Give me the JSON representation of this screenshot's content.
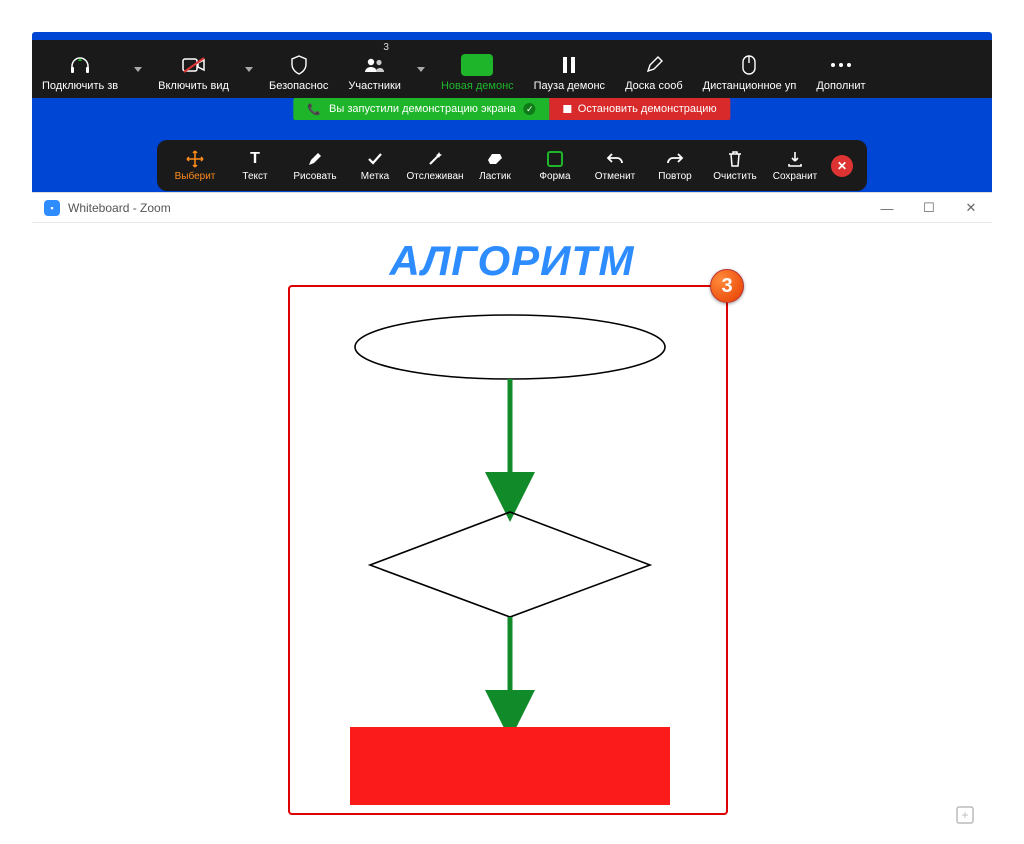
{
  "meeting_toolbar": {
    "audio": "Подключить зв",
    "video": "Включить вид",
    "security": "Безопаснос",
    "participants": "Участники",
    "participants_count": "3",
    "new_share": "Новая демонс",
    "pause_share": "Пауза демонс",
    "whiteboard": "Доска сооб",
    "remote": "Дистанционное уп",
    "more": "Дополнит"
  },
  "share_status": {
    "running": "Вы запустили демонстрацию экрана",
    "stop": "Остановить демонстрацию"
  },
  "annotate": {
    "select": "Выберит",
    "text": "Текст",
    "draw": "Рисовать",
    "stamp": "Метка",
    "spotlight": "Отслеживан",
    "eraser": "Ластик",
    "format": "Форма",
    "undo": "Отменит",
    "redo": "Повтор",
    "clear": "Очистить",
    "save": "Сохранит"
  },
  "whiteboard": {
    "window_title": "Whiteboard - Zoom",
    "heading": "АЛГОРИТМ",
    "step_badge": "3"
  },
  "diagram": {
    "shapes": [
      "terminator-ellipse",
      "arrow-down",
      "decision-rhombus",
      "arrow-down",
      "process-rect-red"
    ]
  }
}
